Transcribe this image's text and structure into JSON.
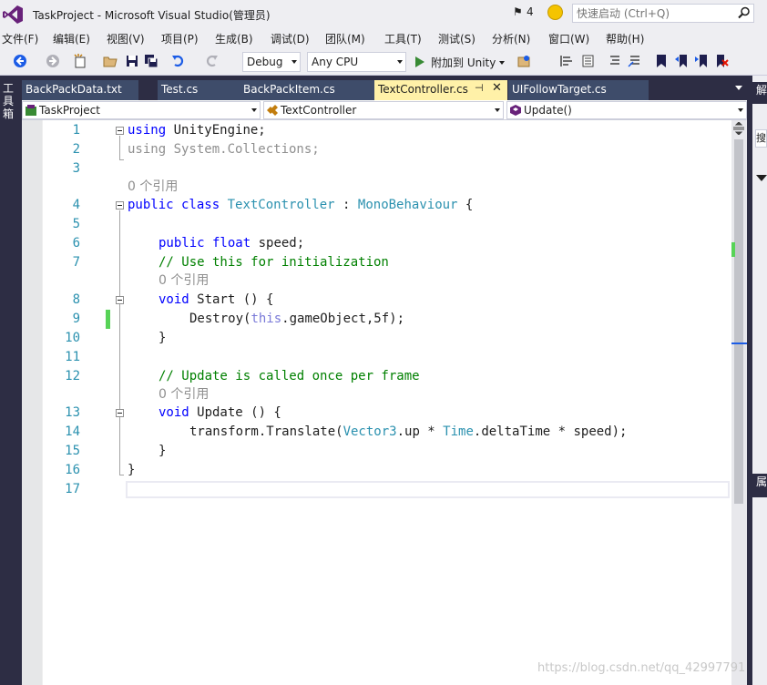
{
  "window": {
    "title": "TaskProject - Microsoft Visual Studio(管理员)",
    "notification_count": "4",
    "quick_launch_placeholder": "快速启动 (Ctrl+Q)"
  },
  "menu": [
    "文件(F)",
    "编辑(E)",
    "视图(V)",
    "项目(P)",
    "生成(B)",
    "调试(D)",
    "团队(M)",
    "工具(T)",
    "测试(S)",
    "分析(N)",
    "窗口(W)",
    "帮助(H)"
  ],
  "toolbar": {
    "config": "Debug",
    "platform": "Any CPU",
    "attach_label": "附加到 Unity"
  },
  "toolbox_label": "工具箱",
  "tabs": [
    {
      "label": "BackPackData.txt",
      "active": false
    },
    {
      "label": "Test.cs",
      "active": false
    },
    {
      "label": "BackPackItem.cs",
      "active": false
    },
    {
      "label": "TextController.cs",
      "active": true
    },
    {
      "label": "UIFollowTarget.cs",
      "active": false
    }
  ],
  "navbar": {
    "project": "TaskProject",
    "class": "TextController",
    "member": "Update()"
  },
  "code": {
    "lens_refs": "0 个引用",
    "l1_kw": "using",
    "l1_rest": " UnityEngine;",
    "l2": "using System.Collections;",
    "l4_kw": "public class",
    "l4_type": "TextController",
    "l4_colon": " : ",
    "l4_base": "MonoBehaviour",
    "l4_brace": " {",
    "l6_kw": "public float",
    "l6_rest": " speed;",
    "l7": "// Use this for initialization",
    "l8_kw": "void",
    "l8_rest": " Start () {",
    "l9_a": "Destroy(",
    "l9_kw": "this",
    "l9_b": ".gameObject,5f);",
    "l10": "}",
    "l12": "// Update is called once per frame",
    "l13_kw": "void",
    "l13_rest": " Update () {",
    "l14_a": "transform.Translate(",
    "l14_t1": "Vector3",
    "l14_b": ".up * ",
    "l14_t2": "Time",
    "l14_c": ".deltaTime * speed);",
    "l15": "}",
    "l16": "}"
  },
  "line_numbers": [
    "1",
    "2",
    "3",
    "4",
    "5",
    "6",
    "7",
    "8",
    "9",
    "10",
    "11",
    "12",
    "13",
    "14",
    "15",
    "16",
    "17"
  ],
  "right_panel": {
    "head1": "解",
    "search": "搜",
    "head2": "属"
  },
  "watermark": "https://blog.csdn.net/qq_42997791"
}
